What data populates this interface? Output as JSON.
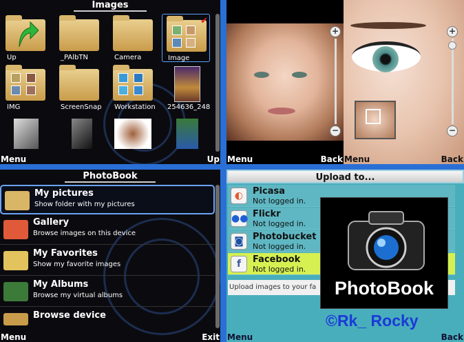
{
  "gallery": {
    "title": "Images",
    "tiles": [
      {
        "label": "Up"
      },
      {
        "label": "_PAlbTN"
      },
      {
        "label": "Camera"
      },
      {
        "label": "Image"
      },
      {
        "label": "IMG"
      },
      {
        "label": "ScreenSnap"
      },
      {
        "label": "Workstation"
      },
      {
        "label": "254636_248"
      }
    ],
    "softkeys": {
      "left": "Menu",
      "right": "Up"
    }
  },
  "viewer": {
    "left_softkeys": {
      "left": "Menu",
      "right": "Back"
    },
    "right_softkeys": {
      "left": "Menu",
      "right": "Back"
    },
    "zoom_in_symbol": "+",
    "zoom_out_symbol": "−"
  },
  "photobook_menu": {
    "title": "PhotoBook",
    "items": [
      {
        "title": "My pictures",
        "subtitle": "Show folder with my pictures",
        "color": "#d9b566"
      },
      {
        "title": "Gallery",
        "subtitle": "Browse images on this device",
        "color": "#e05a3a"
      },
      {
        "title": "My Favorites",
        "subtitle": "Show my favorite images",
        "color": "#e3c35e"
      },
      {
        "title": "My Albums",
        "subtitle": "Browse my virtual albums",
        "color": "#3c7a3a"
      },
      {
        "title": "Browse device",
        "subtitle": "",
        "color": "#c99c4b"
      }
    ],
    "softkeys": {
      "left": "Menu",
      "right": "Exit"
    }
  },
  "upload": {
    "title": "Upload to...",
    "services": [
      {
        "name": "Picasa",
        "status": "Not logged in.",
        "icon": "picasa-icon",
        "color": "#e35b2f",
        "glyph": "◐"
      },
      {
        "name": "Flickr",
        "status": "Not logged in.",
        "icon": "flickr-icon",
        "color": "#1f5fd6",
        "glyph": "●●"
      },
      {
        "name": "Photobucket",
        "status": "Not logged in.",
        "icon": "photobucket-icon",
        "color": "#1c4fa3",
        "glyph": "◙"
      },
      {
        "name": "Facebook",
        "status": "Not logged in.",
        "icon": "facebook-icon",
        "color": "#3b5998",
        "glyph": "f"
      }
    ],
    "footer": "Upload images to your fa",
    "overlay_logo": "PhotoBook",
    "watermark": "©Rk_ Rocky",
    "softkeys": {
      "left": "Menu",
      "right": "Back"
    }
  }
}
